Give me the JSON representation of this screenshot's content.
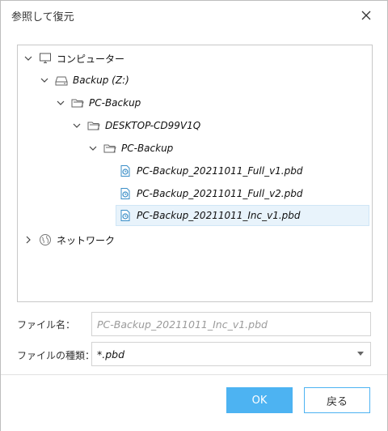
{
  "dialog": {
    "title": "参照して復元"
  },
  "tree": {
    "computer": {
      "label": "コンピューター",
      "icon": "monitor-icon"
    },
    "drive": {
      "label": "Backup (Z:)",
      "icon": "drive-icon"
    },
    "folder1": {
      "label": "PC-Backup",
      "icon": "folder-icon"
    },
    "folder2": {
      "label": "DESKTOP-CD99V1Q",
      "icon": "folder-icon"
    },
    "folder3": {
      "label": "PC-Backup",
      "icon": "folder-icon"
    },
    "files": [
      {
        "label": "PC-Backup_20211011_Full_v1.pbd",
        "icon": "backup-file-icon",
        "selected": false
      },
      {
        "label": "PC-Backup_20211011_Full_v2.pbd",
        "icon": "backup-file-icon",
        "selected": false
      },
      {
        "label": "PC-Backup_20211011_Inc_v1.pbd",
        "icon": "backup-file-icon",
        "selected": true
      }
    ],
    "network": {
      "label": "ネットワーク",
      "icon": "globe-icon"
    }
  },
  "form": {
    "filename_label": "ファイル名：",
    "filename_value": "PC-Backup_20211011_Inc_v1.pbd",
    "filetype_label": "ファイルの種類：",
    "filetype_value": "*.pbd"
  },
  "buttons": {
    "ok": "OK",
    "back": "戻る"
  },
  "colors": {
    "accent": "#4db3f2",
    "selection": "#e8f3fb"
  }
}
